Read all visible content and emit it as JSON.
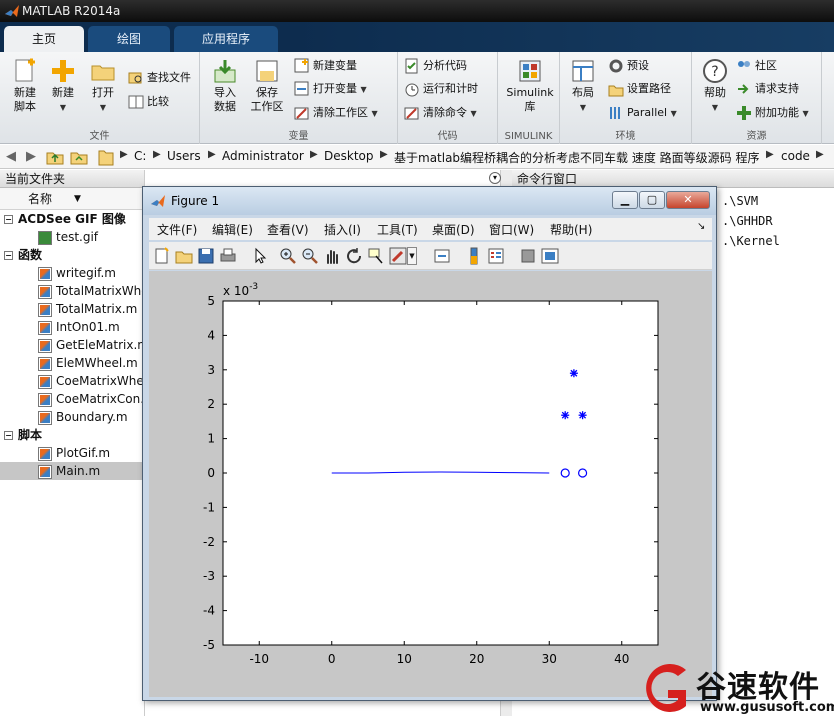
{
  "window": {
    "title": "MATLAB R2014a"
  },
  "tabs": [
    {
      "label": "主页",
      "active": true
    },
    {
      "label": "绘图",
      "active": false
    },
    {
      "label": "应用程序",
      "active": false
    }
  ],
  "ribbon": {
    "file": {
      "label": "文件",
      "new_script": "新建\n脚本",
      "new": "新建",
      "open": "打开",
      "find_files": "查找文件",
      "compare": "比较"
    },
    "variable": {
      "label": "变量",
      "import_data": "导入\n数据",
      "save_workspace": "保存\n工作区",
      "new_variable": "新建变量",
      "open_variable": "打开变量",
      "clear_workspace": "清除工作区"
    },
    "code": {
      "label": "代码",
      "analyze": "分析代码",
      "run_and_time": "运行和计时",
      "clear_commands": "清除命令"
    },
    "simulink": {
      "label": "SIMULINK",
      "simulink_lib": "Simulink\n库"
    },
    "environment": {
      "label": "环境",
      "layout": "布局",
      "preferences": "预设",
      "set_path": "设置路径",
      "parallel": "Parallel"
    },
    "resources": {
      "label": "资源",
      "help": "帮助",
      "community": "社区",
      "request_support": "请求支持",
      "addons": "附加功能"
    }
  },
  "address": {
    "crumbs": [
      "C:",
      "Users",
      "Administrator",
      "Desktop",
      "基于matlab编程桥耦合的分析考虑不同车载 速度 路面等级源码 程序",
      "code"
    ]
  },
  "current_folder": {
    "title": "当前文件夹",
    "column_name": "名称",
    "groups": [
      {
        "label": "ACDSee GIF 图像",
        "files": [
          "test.gif"
        ]
      },
      {
        "label": "函数",
        "files": [
          "writegif.m",
          "TotalMatrixWheel.m",
          "TotalMatrix.m",
          "IntOn01.m",
          "GetEleMatrix.m",
          "EleMWheel.m",
          "CoeMatrixWheel.m",
          "CoeMatrixCon.m",
          "Boundary.m"
        ]
      },
      {
        "label": "脚本",
        "files": [
          "PlotGif.m",
          "Main.m"
        ]
      }
    ],
    "selected_file": "Main.m"
  },
  "command_window": {
    "title": "命令行窗口",
    "lines": [
      ".\\SVM",
      ".\\GHHDR",
      ".\\Kernel"
    ]
  },
  "figure": {
    "title": "Figure 1",
    "menu": [
      "文件(F)",
      "编辑(E)",
      "查看(V)",
      "插入(I)",
      "工具(T)",
      "桌面(D)",
      "窗口(W)",
      "帮助(H)"
    ],
    "toolbar_icons": [
      "new-figure-icon",
      "open-file-icon",
      "save-icon",
      "print-icon",
      "pointer-icon",
      "zoom-in-icon",
      "zoom-out-icon",
      "pan-icon",
      "rotate-icon",
      "data-cursor-icon",
      "brush-icon",
      "link-icon",
      "colorbar-icon",
      "legend-icon",
      "hide-plot-tools-icon",
      "show-plot-tools-icon"
    ]
  },
  "chart_data": {
    "type": "scatter",
    "y_multiplier_label": "x 10",
    "y_multiplier_exponent": "-3",
    "xlim": [
      -15,
      45
    ],
    "ylim": [
      -5,
      5
    ],
    "xticks": [
      -10,
      0,
      10,
      20,
      30,
      40
    ],
    "yticks": [
      5,
      4,
      3,
      2,
      1,
      0,
      -1,
      -2,
      -3,
      -4,
      -5
    ],
    "series": [
      {
        "marker": "line",
        "color": "#0000ff",
        "x": [
          0,
          5,
          10,
          15,
          20,
          25,
          30
        ],
        "y": [
          0.0,
          0.0,
          0.02,
          0.03,
          0.02,
          0.01,
          0.0
        ]
      },
      {
        "marker": "*",
        "color": "#0000ff",
        "x": [
          32.2,
          34.6,
          33.4
        ],
        "y": [
          1.68,
          1.68,
          2.9
        ]
      },
      {
        "marker": "o",
        "color": "#0000ff",
        "x": [
          32.2,
          34.6
        ],
        "y": [
          0.0,
          0.0
        ]
      }
    ]
  },
  "watermark": {
    "name": "谷速软件",
    "url": "www.gususoft.com",
    "color": "#d6201e"
  }
}
